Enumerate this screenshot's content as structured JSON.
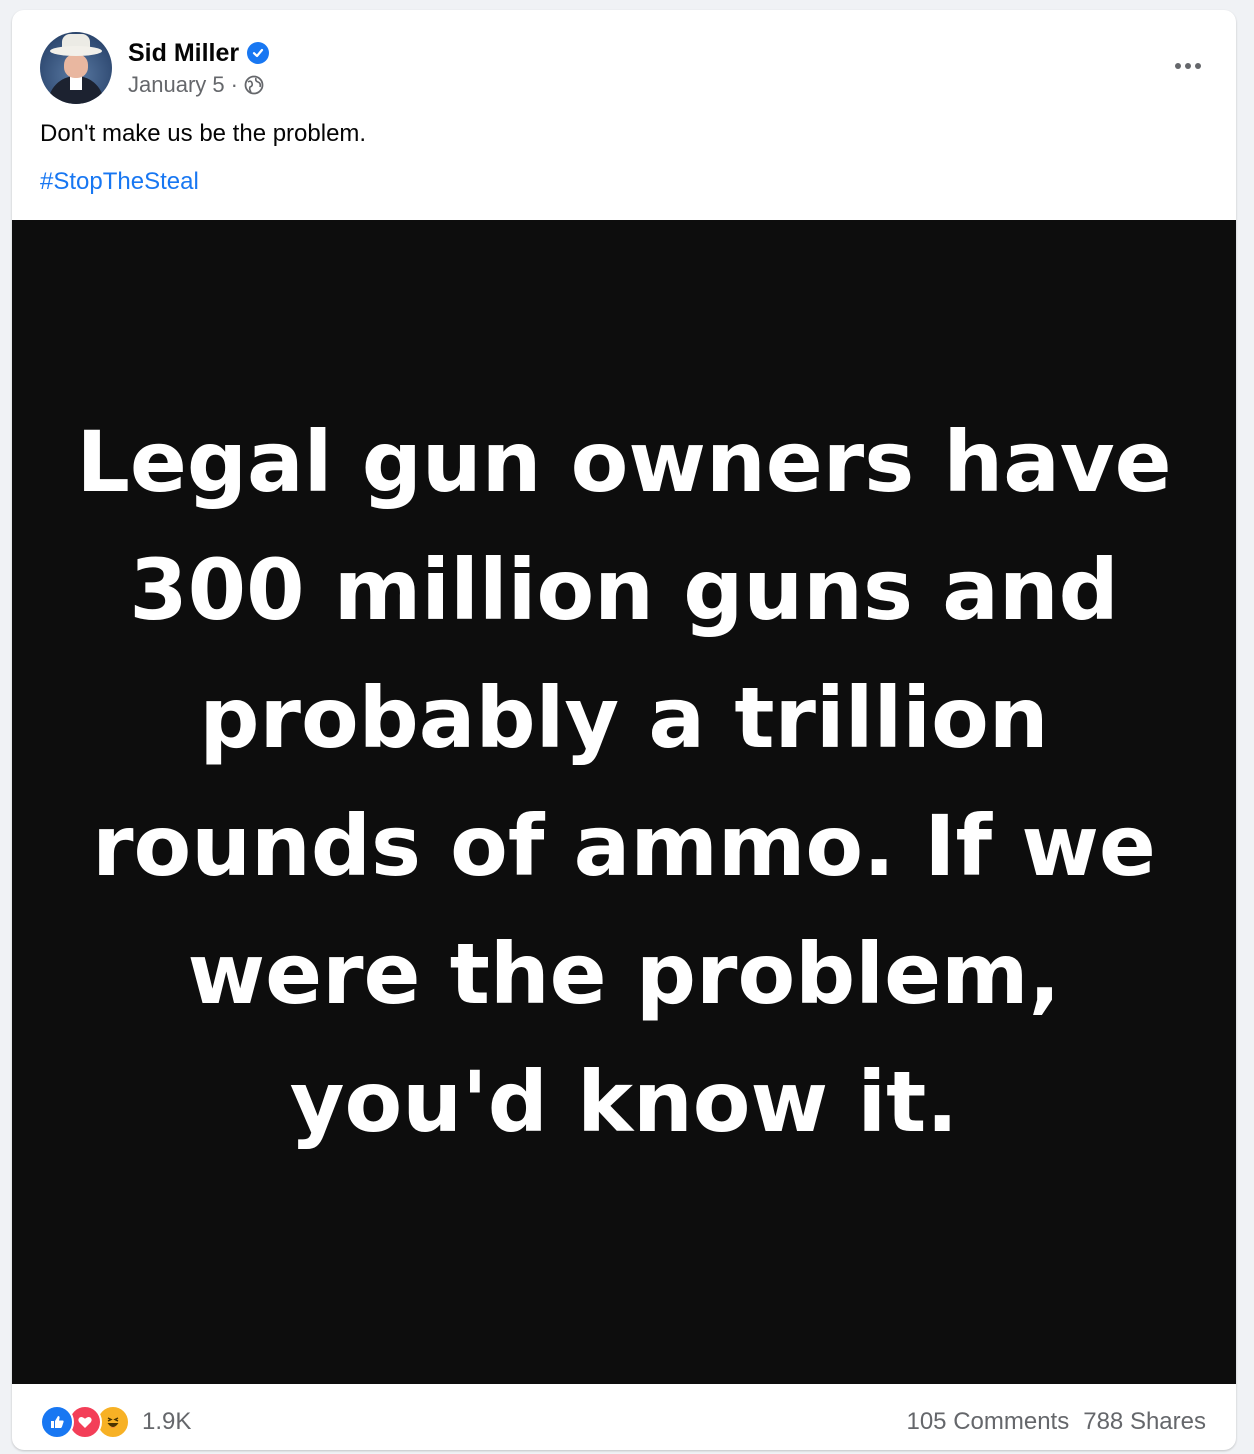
{
  "post": {
    "author": "Sid Miller",
    "date": "January 5",
    "separator": "·",
    "text": "Don't make us be the problem.",
    "hashtag": "#StopTheSteal",
    "image_text": "Legal gun owners have 300 million guns and probably a trillion rounds of ammo. If we were the problem, you'd know it."
  },
  "footer": {
    "reaction_count": "1.9K",
    "comments": "105 Comments",
    "shares": "788 Shares"
  },
  "colors": {
    "accent": "#1877f2",
    "secondary_text": "#65676b",
    "image_background": "#0d0d0d"
  },
  "icons": {
    "verified": "verified-badge-icon",
    "audience": "globe-icon",
    "more": "more-options-icon",
    "reactions": [
      "like-icon",
      "love-icon",
      "haha-icon"
    ]
  }
}
